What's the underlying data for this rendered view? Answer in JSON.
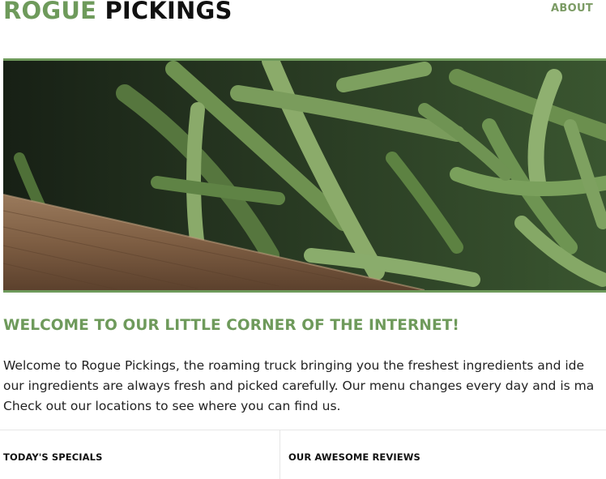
{
  "header": {
    "brand_part1": "ROGUE",
    "brand_part2": "PICKINGS",
    "nav_about": "ABOUT"
  },
  "colors": {
    "brand_green": "#6e9a5b",
    "text_dark": "#111111"
  },
  "welcome": {
    "title": "WELCOME TO OUR LITTLE CORNER OF THE INTERNET!",
    "lines": [
      "Welcome to Rogue Pickings, the roaming truck bringing you the freshest ingredients and ide",
      "our ingredients are always fresh and picked carefully. Our menu changes every day and is ma",
      "Check out our locations to see where you can find us."
    ]
  },
  "sections": {
    "specials_title": "TODAY'S SPECIALS",
    "reviews_title": "OUR AWESOME REVIEWS"
  }
}
